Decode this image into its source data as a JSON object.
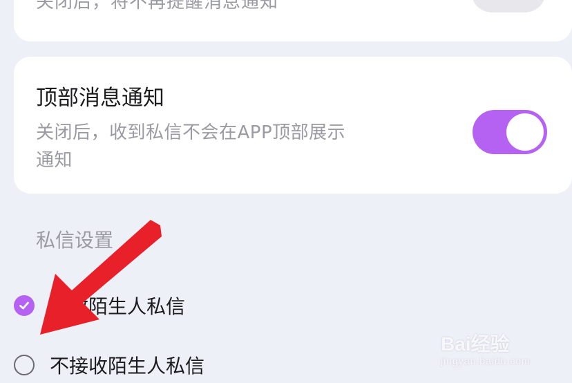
{
  "colors": {
    "page_background": "#eef0f8",
    "card_background": "#ffffff",
    "accent": "#b561f1",
    "annotation_arrow": "#e8202a",
    "secondary_text": "#9a9aa2",
    "primary_text": "#1c1c1e"
  },
  "top_card": {
    "partial_text": "关闭后，将不再提醒消息通知",
    "toggle_state": "off"
  },
  "notification_setting": {
    "title": "顶部消息通知",
    "description": "关闭后，收到私信不会在APP顶部展示通知",
    "toggle_state": "on"
  },
  "private_message_settings": {
    "section_title": "私信设置",
    "options": [
      {
        "label": "接收陌生人私信",
        "selected": true,
        "icon": "check-icon"
      },
      {
        "label": "不接收陌生人私信",
        "selected": false,
        "icon": "radio-empty-icon"
      }
    ]
  },
  "watermark": {
    "brand": "Bai经验",
    "url": "jingyan.baidu.com"
  }
}
